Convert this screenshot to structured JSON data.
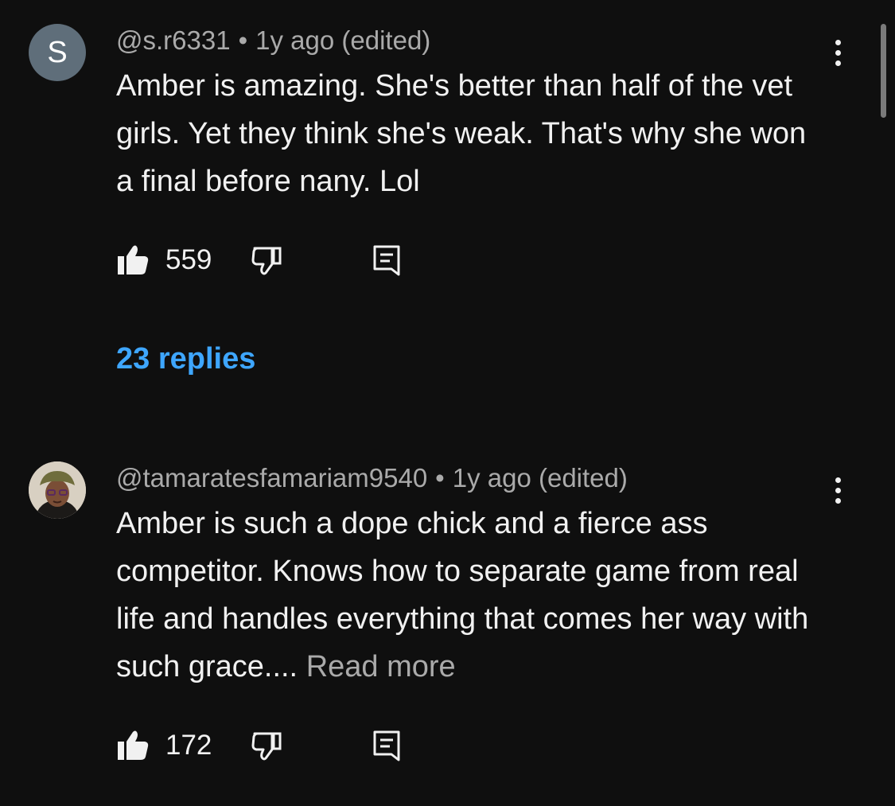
{
  "comments": [
    {
      "avatar_letter": "S",
      "handle": "@s.r6331",
      "separator": "•",
      "time": "1y ago (edited)",
      "text": "Amber is amazing. She's better than half of the vet girls. Yet they think she's weak. That's why she won a final before nany. Lol",
      "read_more": "",
      "likes": "559",
      "replies_label": "23 replies",
      "icons": {
        "like": "thumbs-up-icon",
        "dislike": "thumbs-down-icon",
        "reply": "comment-icon",
        "menu": "kebab-menu-icon"
      }
    },
    {
      "avatar_letter": "",
      "handle": "@tamaratesfamariam9540",
      "separator": "•",
      "time": "1y ago (edited)",
      "text": "Amber is such a dope chick and a fierce ass competitor. Knows how to separate game from real life and handles everything that comes her way with such grace....",
      "read_more": "Read more",
      "likes": "172",
      "replies_label": "",
      "icons": {
        "like": "thumbs-up-icon",
        "dislike": "thumbs-down-icon",
        "reply": "comment-icon",
        "menu": "kebab-menu-icon"
      }
    }
  ],
  "colors": {
    "background": "#0f0f0f",
    "text_primary": "#f1f1f1",
    "text_secondary": "#aaaaaa",
    "link_blue": "#3ea6ff",
    "avatar_gray": "#5f6e7a"
  }
}
